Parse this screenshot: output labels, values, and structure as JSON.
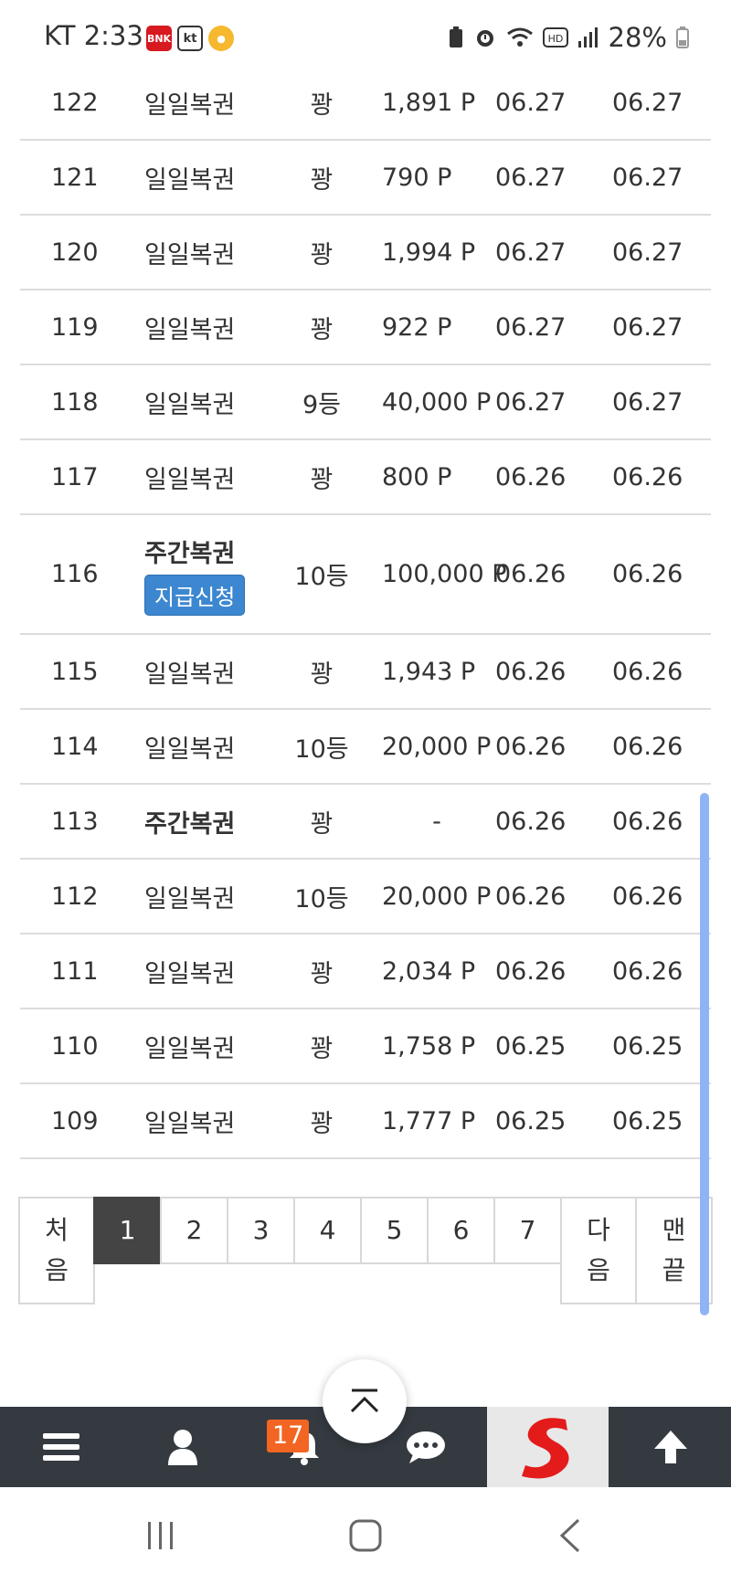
{
  "status_bar": {
    "time": "KT 2:33",
    "apps": [
      "BNK",
      "kt",
      ""
    ],
    "battery": "28%"
  },
  "rows": [
    {
      "num": "122",
      "type": "일일복권",
      "type_bold": false,
      "rank": "꽝",
      "point": "1,891 P",
      "date1": "06.27",
      "date2": "06.27"
    },
    {
      "num": "121",
      "type": "일일복권",
      "type_bold": false,
      "rank": "꽝",
      "point": "790 P",
      "date1": "06.27",
      "date2": "06.27"
    },
    {
      "num": "120",
      "type": "일일복권",
      "type_bold": false,
      "rank": "꽝",
      "point": "1,994 P",
      "date1": "06.27",
      "date2": "06.27"
    },
    {
      "num": "119",
      "type": "일일복권",
      "type_bold": false,
      "rank": "꽝",
      "point": "922 P",
      "date1": "06.27",
      "date2": "06.27"
    },
    {
      "num": "118",
      "type": "일일복권",
      "type_bold": false,
      "rank": "9등",
      "point": "40,000 P",
      "date1": "06.27",
      "date2": "06.27"
    },
    {
      "num": "117",
      "type": "일일복권",
      "type_bold": false,
      "rank": "꽝",
      "point": "800 P",
      "date1": "06.26",
      "date2": "06.26"
    },
    {
      "num": "116",
      "type": "주간복권",
      "type_bold": true,
      "claim_label": "지급신청",
      "rank": "10등",
      "point": "100,000 P",
      "date1": "06.26",
      "date2": "06.26"
    },
    {
      "num": "115",
      "type": "일일복권",
      "type_bold": false,
      "rank": "꽝",
      "point": "1,943 P",
      "date1": "06.26",
      "date2": "06.26"
    },
    {
      "num": "114",
      "type": "일일복권",
      "type_bold": false,
      "rank": "10등",
      "point": "20,000 P",
      "date1": "06.26",
      "date2": "06.26"
    },
    {
      "num": "113",
      "type": "주간복권",
      "type_bold": true,
      "rank": "꽝",
      "point": "-",
      "date1": "06.26",
      "date2": "06.26"
    },
    {
      "num": "112",
      "type": "일일복권",
      "type_bold": false,
      "rank": "10등",
      "point": "20,000 P",
      "date1": "06.26",
      "date2": "06.26"
    },
    {
      "num": "111",
      "type": "일일복권",
      "type_bold": false,
      "rank": "꽝",
      "point": "2,034 P",
      "date1": "06.26",
      "date2": "06.26"
    },
    {
      "num": "110",
      "type": "일일복권",
      "type_bold": false,
      "rank": "꽝",
      "point": "1,758 P",
      "date1": "06.25",
      "date2": "06.25"
    },
    {
      "num": "109",
      "type": "일일복권",
      "type_bold": false,
      "rank": "꽝",
      "point": "1,777 P",
      "date1": "06.25",
      "date2": "06.25"
    }
  ],
  "pagination": {
    "first": "처\n음",
    "pages": [
      "1",
      "2",
      "3",
      "4",
      "5",
      "6",
      "7"
    ],
    "active": "1",
    "next": "다\n음",
    "last": "맨\n끝"
  },
  "bottom_nav": {
    "notification_count": "17",
    "items": [
      "menu-icon",
      "user-icon",
      "bell-icon",
      "chat-icon",
      "site-logo",
      "arrow-up-icon"
    ]
  },
  "colors": {
    "claim_button": "#3d87d1",
    "nav_bg": "#343a40",
    "badge": "#f26522",
    "active_page": "#444444",
    "scroll_thumb": "#8fb3f5"
  }
}
